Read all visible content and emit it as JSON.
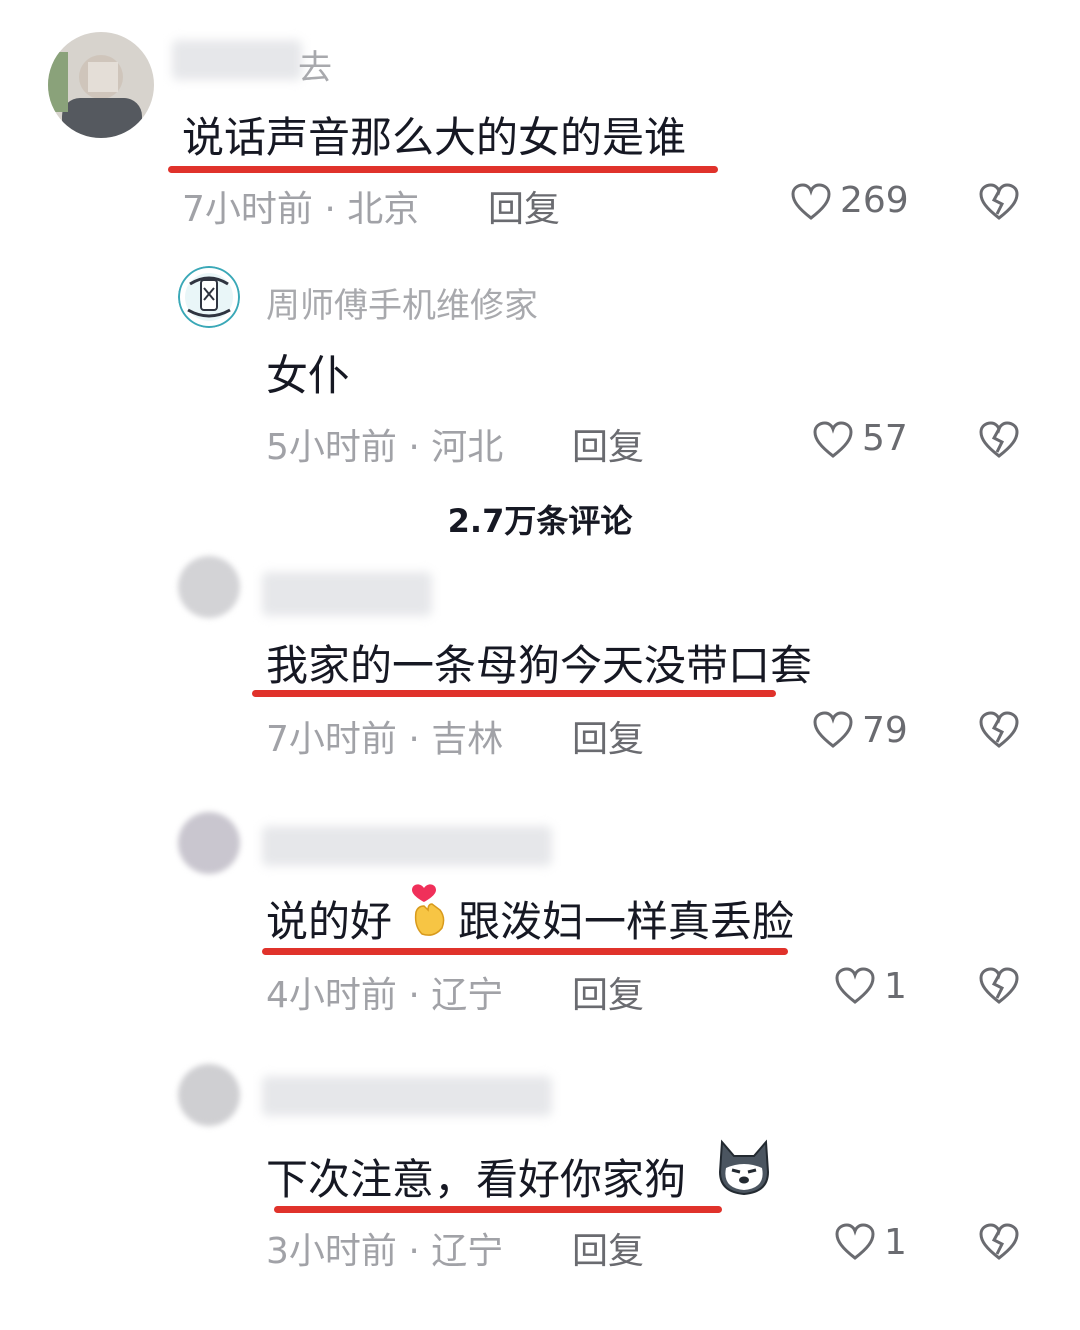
{
  "comment_count_label": "2.7万条评论",
  "comments": [
    {
      "username": "去",
      "text": "说话声音那么大的女的是谁",
      "time": "7小时前",
      "location": "北京",
      "reply": "回复",
      "likes": "269",
      "underlined": true
    },
    {
      "username": "周师傅手机维修家",
      "text": "女仆",
      "time": "5小时前",
      "location": "河北",
      "reply": "回复",
      "likes": "57",
      "underlined": false
    },
    {
      "username": "",
      "text": "我家的一条母狗今天没带口套",
      "time": "7小时前",
      "location": "吉林",
      "reply": "回复",
      "likes": "79",
      "underlined": true
    },
    {
      "username": "",
      "text_before_emoji": "说的好",
      "emoji": "finger-heart-emoji",
      "text_after_emoji": "跟泼妇一样真丢脸",
      "time": "4小时前",
      "location": "辽宁",
      "reply": "回复",
      "likes": "1",
      "underlined": true
    },
    {
      "username": "",
      "text": "下次注意，看好你家狗",
      "emoji": "husky-dog-emoji",
      "time": "3小时前",
      "location": "辽宁",
      "reply": "回复",
      "likes": "1",
      "underlined": true
    }
  ],
  "meta_separator": " · ",
  "colors": {
    "underline": "#e0322b",
    "secondary_text": "#a1a2a7",
    "primary_text": "#161823"
  },
  "icons": {
    "like": "heart-outline-icon",
    "dislike": "broken-heart-icon",
    "repair_shop_avatar": "phone-repair-icon"
  }
}
